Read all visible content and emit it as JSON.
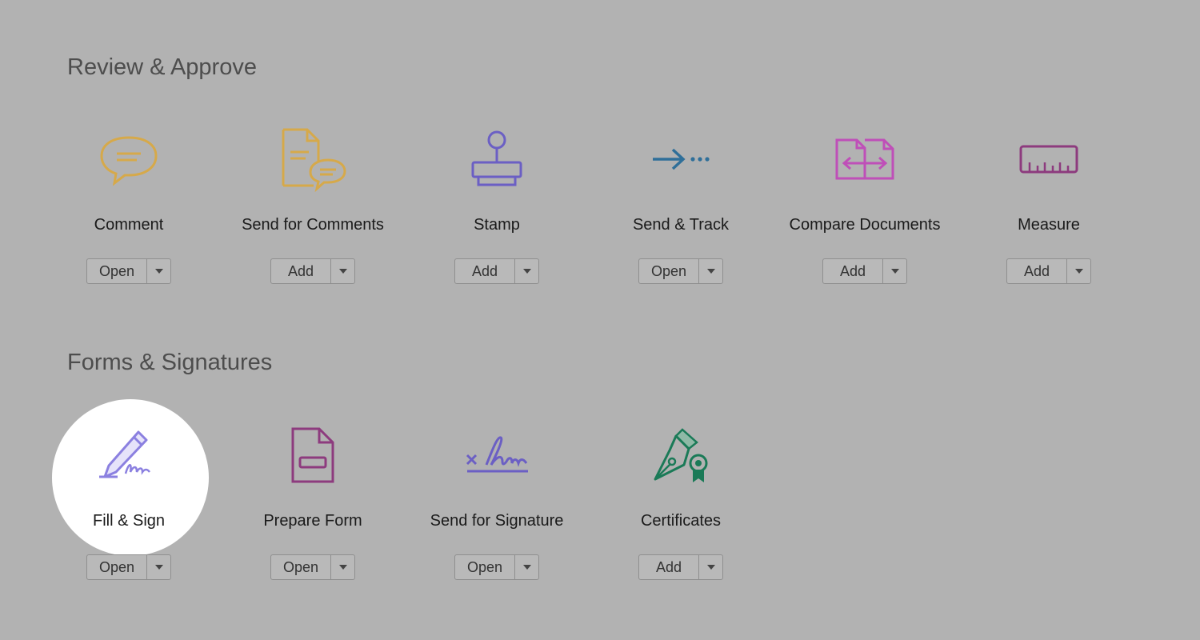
{
  "sections": [
    {
      "title": "Review & Approve",
      "tools": [
        {
          "label": "Comment",
          "button": "Open",
          "icon": "comment-icon"
        },
        {
          "label": "Send for Comments",
          "button": "Add",
          "icon": "send-for-comments-icon"
        },
        {
          "label": "Stamp",
          "button": "Add",
          "icon": "stamp-icon"
        },
        {
          "label": "Send & Track",
          "button": "Open",
          "icon": "send-track-icon"
        },
        {
          "label": "Compare Documents",
          "button": "Add",
          "icon": "compare-documents-icon"
        },
        {
          "label": "Measure",
          "button": "Add",
          "icon": "measure-icon"
        }
      ]
    },
    {
      "title": "Forms & Signatures",
      "tools": [
        {
          "label": "Fill & Sign",
          "button": "Open",
          "icon": "fill-sign-icon"
        },
        {
          "label": "Prepare Form",
          "button": "Open",
          "icon": "prepare-form-icon"
        },
        {
          "label": "Send for Signature",
          "button": "Open",
          "icon": "send-for-signature-icon"
        },
        {
          "label": "Certificates",
          "button": "Add",
          "icon": "certificates-icon"
        }
      ]
    }
  ],
  "colors": {
    "background": "#b2b2b2",
    "spotlight": "#ffffff",
    "comment": "#d6a94a",
    "stamp": "#6b5fc4",
    "send_track": "#2f6f99",
    "compare": "#bf4fb8",
    "measure": "#8d3b7e",
    "fill_sign": "#8b80e0",
    "prepare_form": "#8d3b7e",
    "signature": "#6b5fc4",
    "certificates": "#1a7a57"
  }
}
